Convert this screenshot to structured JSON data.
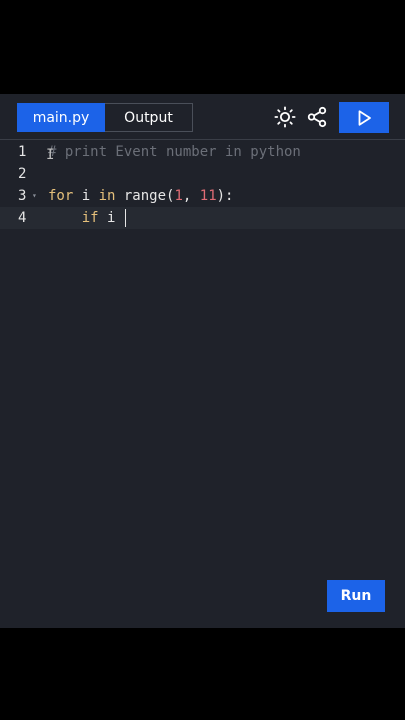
{
  "tabs": {
    "main": "main.py",
    "output": "Output"
  },
  "icons": {
    "theme": "sun-icon",
    "share": "share-icon",
    "run": "play-icon"
  },
  "editor": {
    "lines": [
      {
        "number": "1",
        "comment": "# print Event number in python"
      },
      {
        "number": "2"
      },
      {
        "number": "3",
        "kw": "for",
        "a": " i ",
        "kw2": "in",
        "b": " range(",
        "n1": "1",
        "c": ", ",
        "n2": "11",
        "d": "):"
      },
      {
        "number": "4",
        "indent": "    ",
        "kw": "if",
        "a": " i "
      }
    ]
  },
  "run_button": "Run",
  "colors": {
    "accent": "#1c63e8",
    "background": "#1f222a",
    "keyword": "#e5c07b",
    "number": "#e06c75",
    "comment": "#6b6f78"
  }
}
